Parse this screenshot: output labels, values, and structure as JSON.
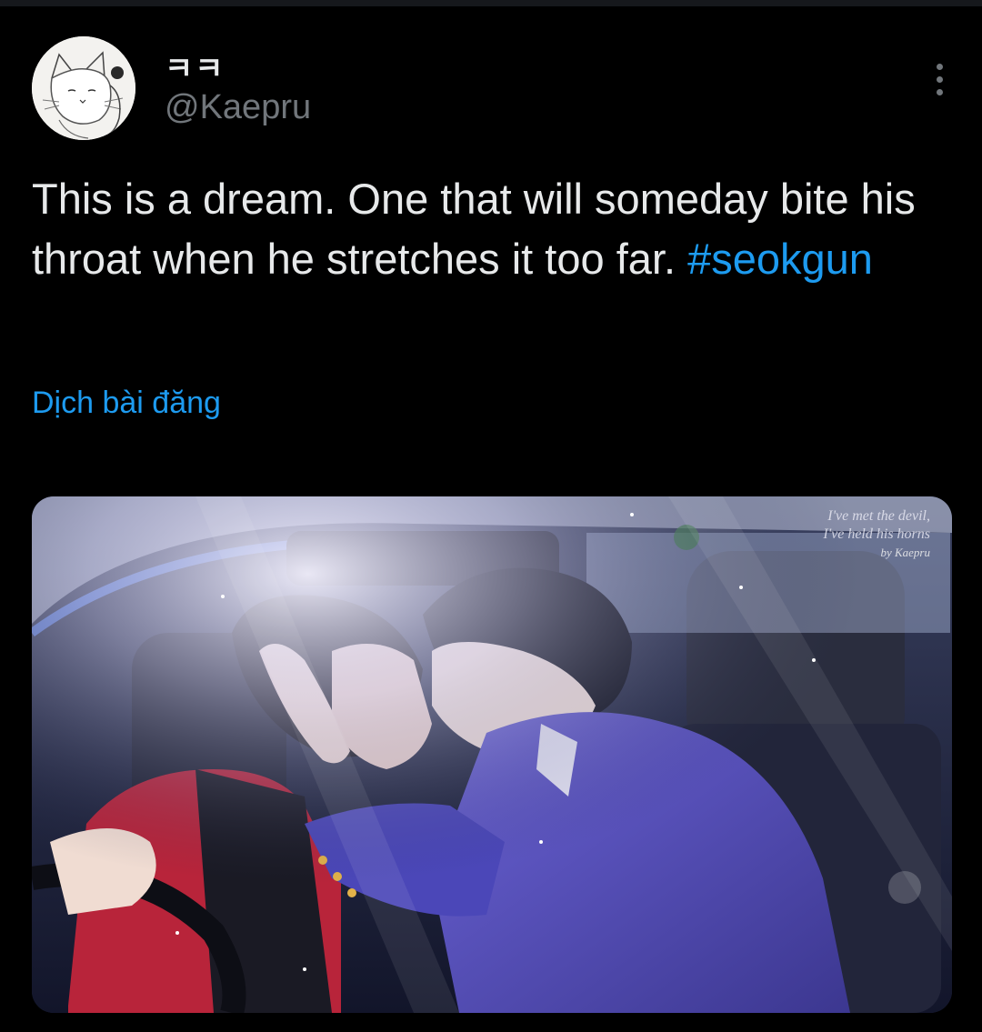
{
  "author": {
    "display_name": "ㅋㅋ",
    "handle": "@Kaepru"
  },
  "icons": {
    "avatar": "avatar-icon",
    "more": "more-vertical-icon"
  },
  "tweet": {
    "text": "This is a dream. One that will someday bite his throat when he stretches it too far. ",
    "hashtag": "#seokgun",
    "translate_label": "Dịch bài đăng"
  },
  "media": {
    "watermark_line1": "I've met the devil,",
    "watermark_line2": "I've held his horns",
    "watermark_signature": "by Kaepru"
  },
  "colors": {
    "background": "#000000",
    "text": "#e7e9ea",
    "secondary": "#71767b",
    "link": "#1d9bf0"
  }
}
